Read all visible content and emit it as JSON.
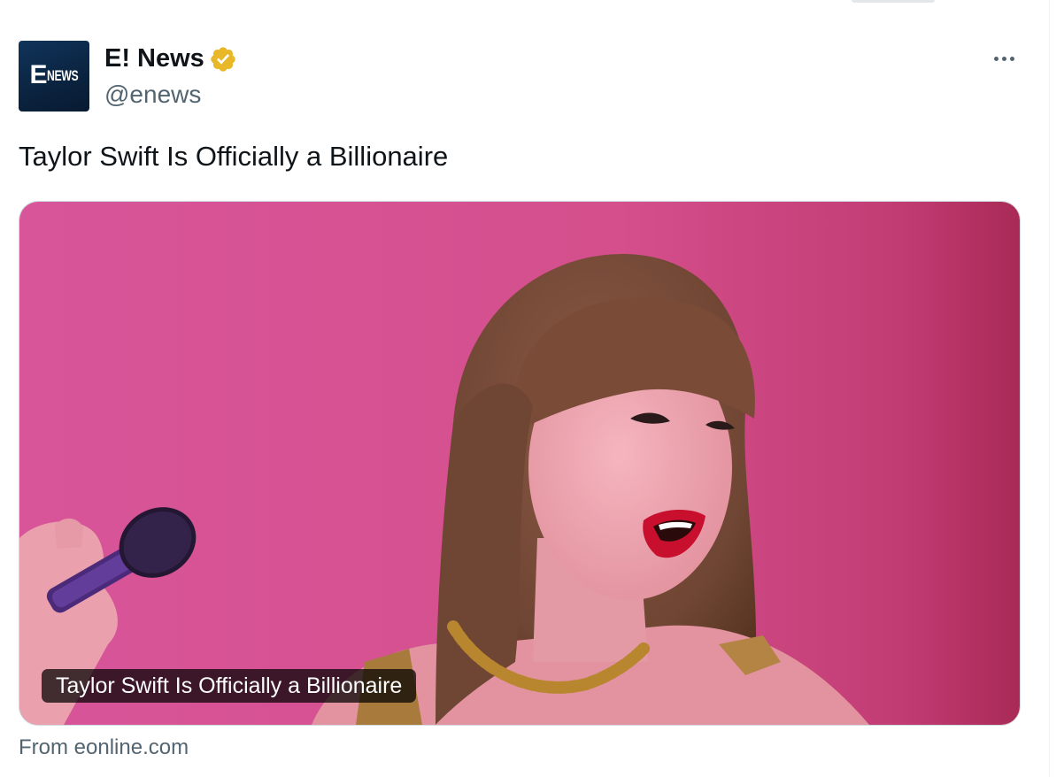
{
  "account": {
    "avatar_letter": "E",
    "avatar_text": "NEWS",
    "display_name": "E! News",
    "handle": "@enews",
    "verified_icon": "verified-badge-icon",
    "badge_color": "#e8b829"
  },
  "post": {
    "text": "Taylor Swift Is Officially a Billionaire"
  },
  "link_card": {
    "title": "Taylor Swift Is Officially a Billionaire",
    "source": "From eonline.com",
    "background_color": "#d44f8c"
  },
  "actions": {
    "more_icon": "more-horizontal-icon"
  }
}
